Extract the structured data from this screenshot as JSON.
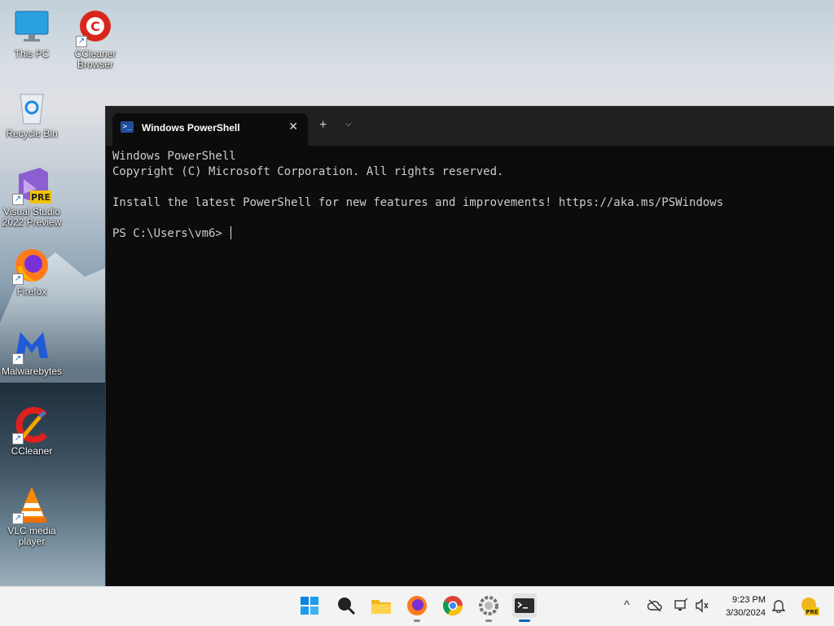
{
  "desktop": {
    "icons": [
      {
        "label": "This PC",
        "icon": "monitor-icon"
      },
      {
        "label": "CCleaner Browser",
        "icon": "ccleaner-browser-icon"
      },
      {
        "label": "Recycle Bin",
        "icon": "recycle-bin-icon"
      },
      {
        "label": "Visual Studio 2022 Preview",
        "icon": "visual-studio-icon",
        "badge": "PRE"
      },
      {
        "label": "Firefox",
        "icon": "firefox-icon"
      },
      {
        "label": "Malwarebytes",
        "icon": "malwarebytes-icon"
      },
      {
        "label": "CCleaner",
        "icon": "ccleaner-icon"
      },
      {
        "label": "VLC media player",
        "icon": "vlc-icon"
      }
    ],
    "shortcut_arrow": "↗"
  },
  "terminal": {
    "tab_title": "Windows PowerShell",
    "tab_icon_glyph": ">_",
    "close_glyph": "✕",
    "new_tab_glyph": "+",
    "dropdown_glyph": "⌵",
    "lines": [
      "Windows PowerShell",
      "Copyright (C) Microsoft Corporation. All rights reserved.",
      "",
      "Install the latest PowerShell for new features and improvements! https://aka.ms/PSWindows",
      "",
      "PS C:\\Users\\vm6> "
    ]
  },
  "taskbar": {
    "apps": [
      "start-icon",
      "search-icon",
      "file-explorer-icon",
      "firefox-icon",
      "chrome-icon",
      "settings-icon",
      "terminal-icon"
    ],
    "tray": {
      "chevron": "^",
      "time": "9:23 PM",
      "date": "3/30/2024"
    },
    "pre_badge": "PRE"
  },
  "colors": {
    "terminal_bg": "#0c0c0c",
    "tabbar_bg": "#202020",
    "accent": "#0067c0"
  }
}
